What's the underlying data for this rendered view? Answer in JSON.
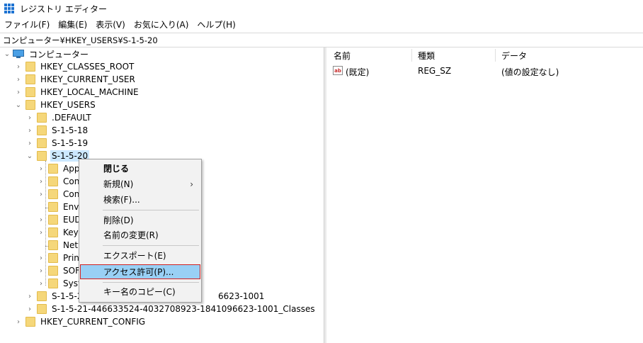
{
  "window": {
    "title": "レジストリ エディター"
  },
  "menu": [
    "ファイル(F)",
    "編集(E)",
    "表示(V)",
    "お気に入り(A)",
    "ヘルプ(H)"
  ],
  "address": "コンピューター¥HKEY_USERS¥S-1-5-20",
  "tree": {
    "root": "コンピューター",
    "hkcr": "HKEY_CLASSES_ROOT",
    "hkcu": "HKEY_CURRENT_USER",
    "hklm": "HKEY_LOCAL_MACHINE",
    "hku": "HKEY_USERS",
    "default": ".DEFAULT",
    "s18": "S-1-5-18",
    "s19": "S-1-5-19",
    "s20": "S-1-5-20",
    "sub": [
      "App",
      "Con",
      "Con",
      "Envi",
      "EUD",
      "Keyl",
      "Netw",
      "Prin",
      "SOF",
      "Syst"
    ],
    "long1_pre": "S-1-5-2",
    "long1_post": "6623-1001",
    "long2": "S-1-5-21-446633524-4032708923-1841096623-1001_Classes",
    "hkcc": "HKEY_CURRENT_CONFIG"
  },
  "list": {
    "headers": {
      "name": "名前",
      "type": "種類",
      "data": "データ"
    },
    "rows": [
      {
        "name": "(既定)",
        "type": "REG_SZ",
        "data": "(値の設定なし)"
      }
    ]
  },
  "context_menu": {
    "collapse": "閉じる",
    "new": "新規(N)",
    "find": "検索(F)...",
    "delete": "削除(D)",
    "rename": "名前の変更(R)",
    "export": "エクスポート(E)",
    "permissions": "アクセス許可(P)...",
    "copy_key_name": "キー名のコピー(C)"
  }
}
